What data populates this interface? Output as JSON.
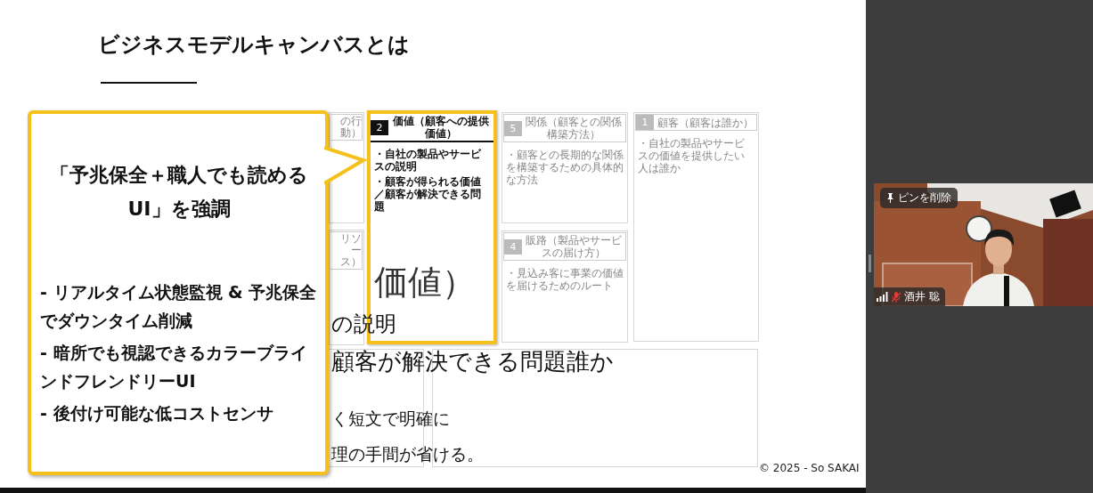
{
  "slide": {
    "title": "ビジネスモデルキャンバスとは",
    "canvas_cards": [
      {
        "heading": "の行動）",
        "highlighted": false
      },
      {
        "number": "2",
        "heading": "価値（顧客への提供価値）",
        "bullets": [
          "・自社の製品やサービスの説明",
          "・顧客が得られる価値／顧客が解決できる問題"
        ],
        "highlighted": true
      },
      {
        "number": "5",
        "heading": "関係（顧客との関係構築方法）",
        "bullets": [
          "・顧客との長期的な関係を構築するための具体的な方法"
        ],
        "highlighted": false
      },
      {
        "number": "1",
        "heading": "顧客（顧客は誰か）",
        "bullets": [
          "・自社の製品やサービスの価値を提供したい人は誰か"
        ],
        "highlighted": false
      },
      {
        "heading": "リソース）",
        "highlighted": false
      },
      {
        "number": "4",
        "heading": "販路（製品やサービスの届け方）",
        "bullets": [
          "・見込み客に事業の価値を届けるためのルート"
        ],
        "highlighted": false
      }
    ],
    "body_fragments": [
      "価値）",
      "の説明",
      "顧客が解決できる問題誰か",
      "く短文で明確に",
      "理の手間が省ける。"
    ],
    "copyright": "© 2025 - So SAKAI"
  },
  "callout": {
    "heading": "「予兆保全＋職人でも読めるUI」を強調",
    "bullets": [
      "- リアルタイム状態監視 & 予兆保全でダウンタイム削減",
      "- 暗所でも視認できるカラーブラインドフレンドリーUI",
      "- 後付け可能な低コストセンサ"
    ]
  },
  "video_tile": {
    "pin_button": "ピンを削除",
    "participant_name": "酒井 聡",
    "muted": true
  }
}
